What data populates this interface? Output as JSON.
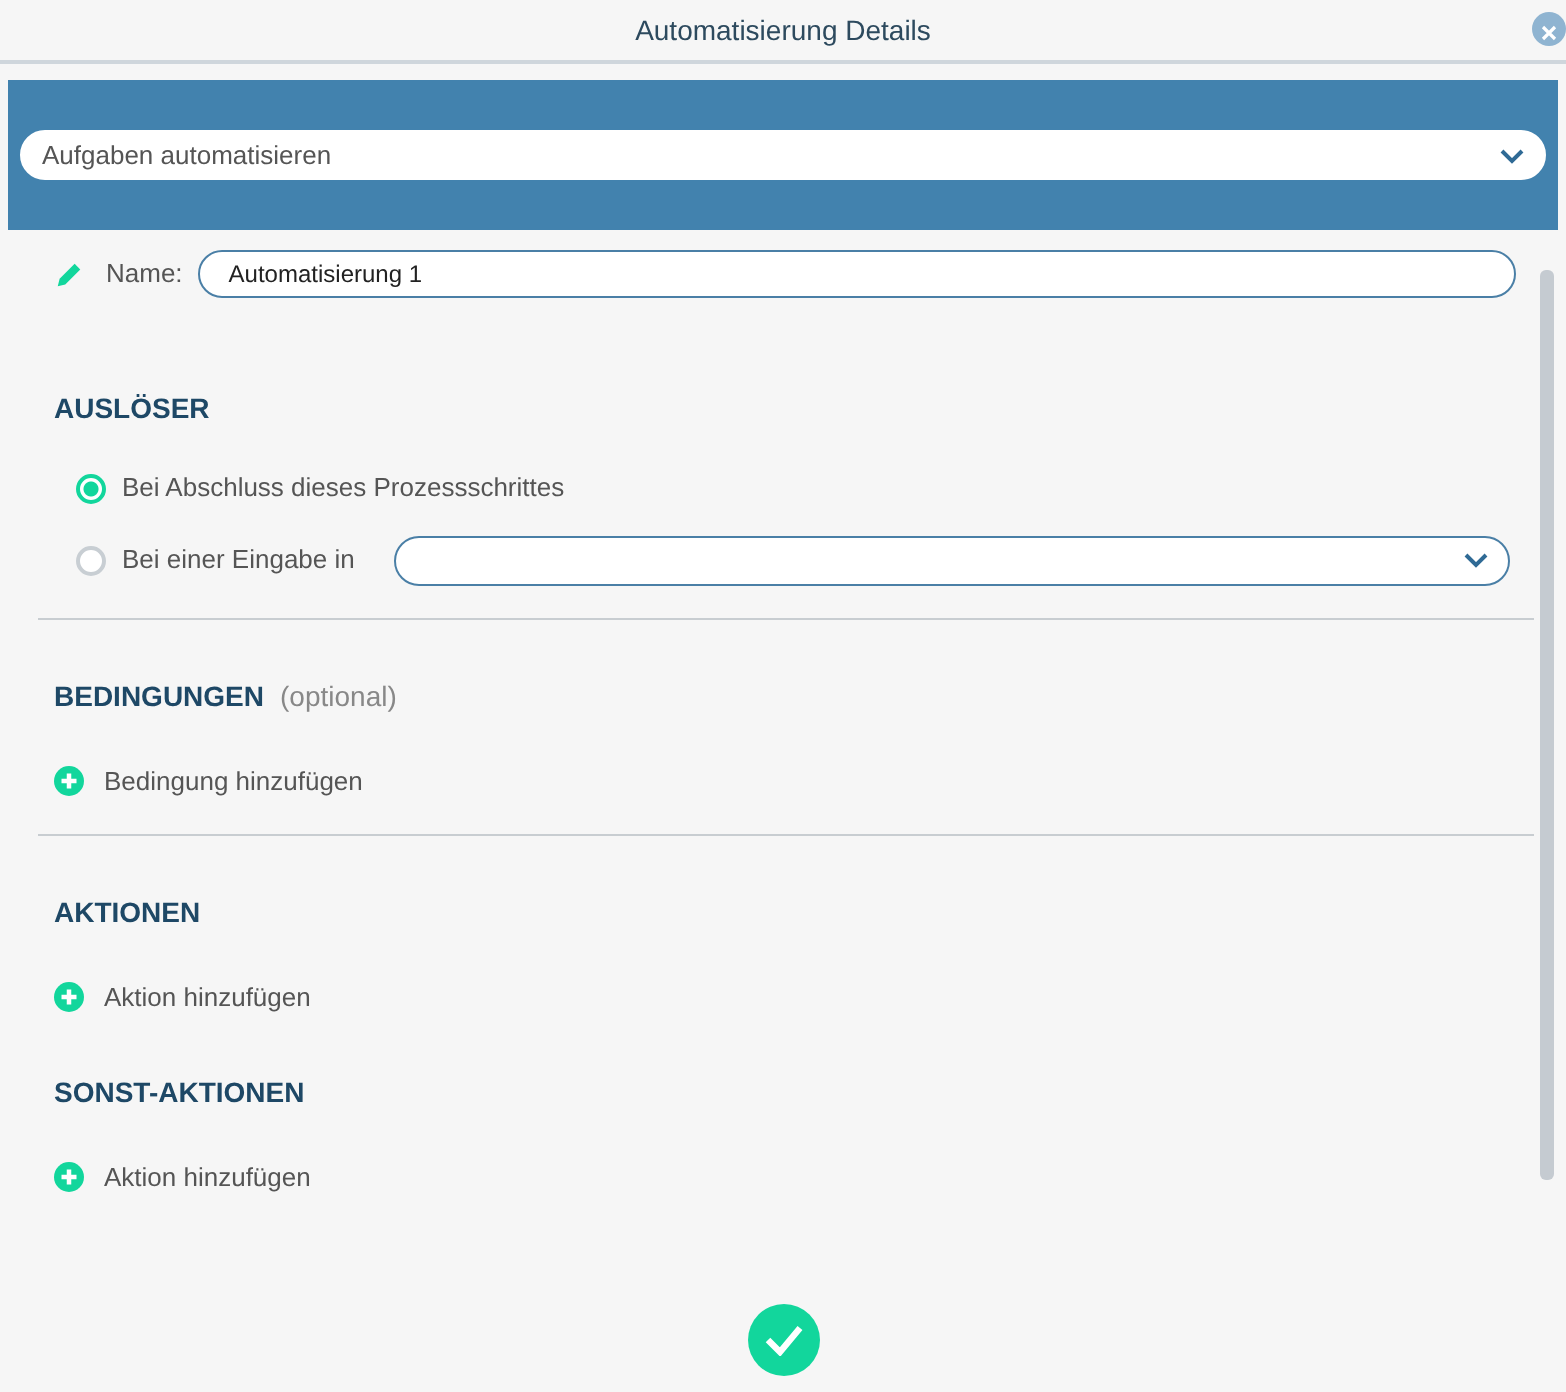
{
  "window": {
    "title": "Automatisierung Details"
  },
  "template_select": {
    "value": "Aufgaben automatisieren"
  },
  "name_field": {
    "label": "Name:",
    "value": "Automatisierung 1"
  },
  "sections": [
    {
      "kind": "trigger",
      "title": "AUSLÖSER",
      "divider_after": true,
      "options": [
        {
          "label": "Bei Abschluss dieses Prozessschrittes",
          "selected": true,
          "kind": "plain"
        },
        {
          "label": "Bei einer Eingabe in",
          "selected": false,
          "kind": "select"
        }
      ]
    },
    {
      "kind": "add",
      "title": "BEDINGUNGEN",
      "note": "(optional)",
      "add_label": "Bedingung hinzufügen",
      "divider_after": true
    },
    {
      "kind": "add",
      "title": "AKTIONEN",
      "add_label": "Aktion hinzufügen",
      "divider_after": false
    },
    {
      "kind": "add",
      "title": "SONST-AKTIONEN",
      "add_label": "Aktion hinzufügen",
      "divider_after": false
    }
  ]
}
